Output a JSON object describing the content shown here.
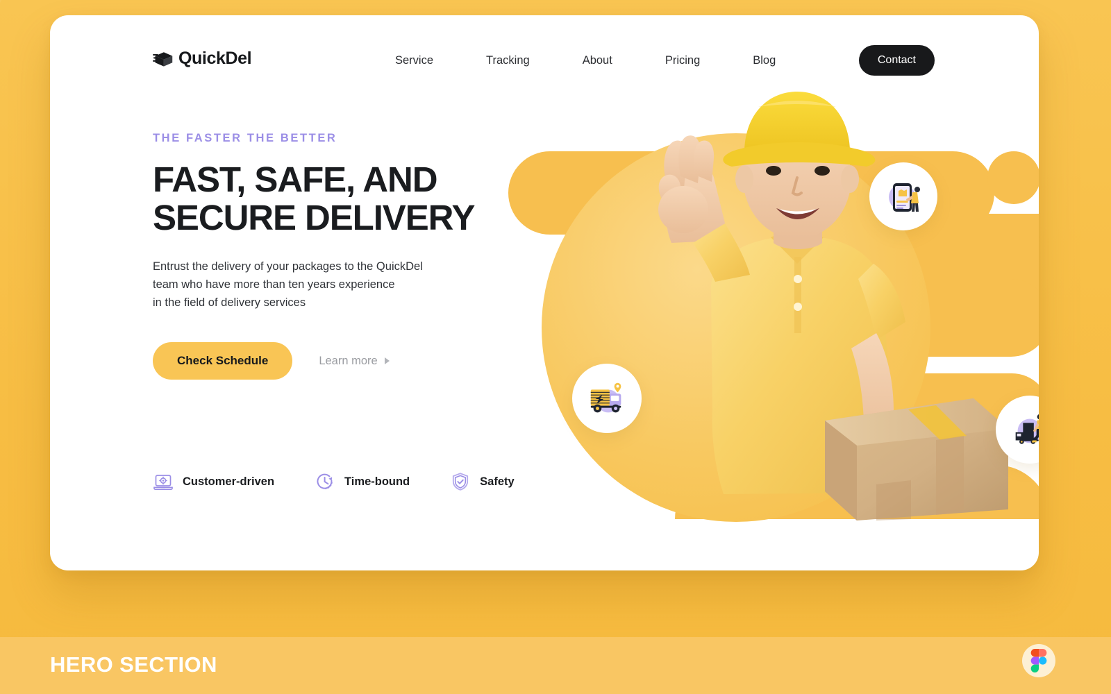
{
  "brand": {
    "name": "QuickDel",
    "logo_icon": "package-box-icon"
  },
  "nav": {
    "links": [
      {
        "label": "Service"
      },
      {
        "label": "Tracking"
      },
      {
        "label": "About"
      },
      {
        "label": "Pricing"
      },
      {
        "label": "Blog"
      }
    ],
    "contact_label": "Contact"
  },
  "hero": {
    "eyebrow": "THE FASTER THE BETTER",
    "headline_line1": "FAST, SAFE, AND",
    "headline_line2": "SECURE DELIVERY",
    "subcopy_line1": "Entrust the delivery of your packages to the QuickDel",
    "subcopy_line2": "team who have more than ten years experience",
    "subcopy_line3": "in the field of delivery services",
    "primary_cta": "Check Schedule",
    "secondary_cta": "Learn more"
  },
  "features": [
    {
      "label": "Customer-driven",
      "icon": "laptop-gear-icon"
    },
    {
      "label": "Time-bound",
      "icon": "clock-icon"
    },
    {
      "label": "Safety",
      "icon": "shield-check-icon"
    }
  ],
  "hero_art": {
    "photo_alt": "delivery-courier-holding-package",
    "float_icons": [
      {
        "icon": "mobile-shopping-icon"
      },
      {
        "icon": "delivery-truck-icon"
      },
      {
        "icon": "hand-truck-worker-icon"
      }
    ]
  },
  "footer": {
    "title": "HERO SECTION",
    "badge_icon": "figma-logo-icon"
  },
  "colors": {
    "page_background": "#F8C04A",
    "card_background": "#FFFFFF",
    "accent_yellow": "#F9C555",
    "accent_purple": "#9B8EE6",
    "ink": "#18191B",
    "footer_band": "#F9C663"
  }
}
